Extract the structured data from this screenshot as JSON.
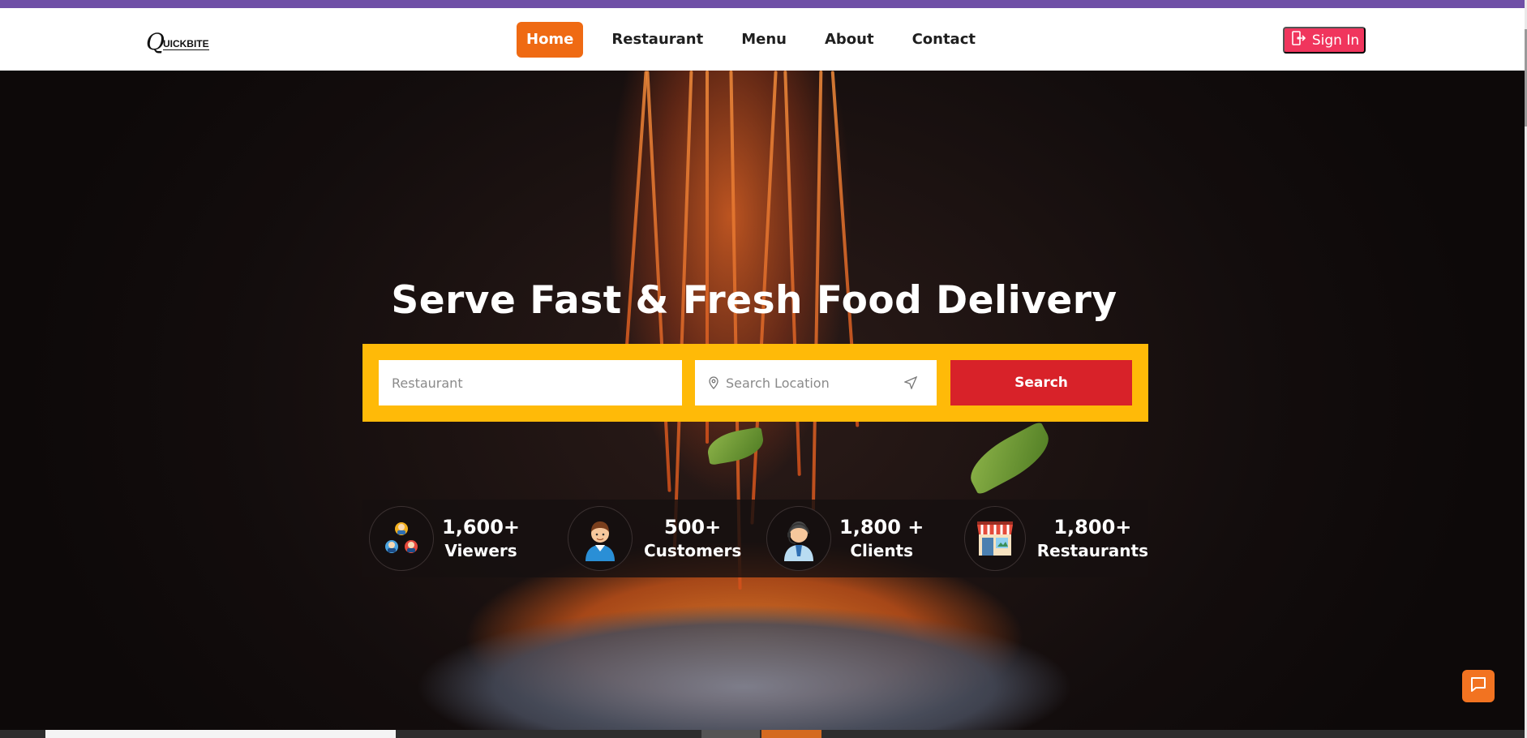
{
  "brand": {
    "logo_initial": "Q",
    "logo_rest": "UICKBITE"
  },
  "nav": {
    "items": [
      {
        "label": "Home",
        "active": true
      },
      {
        "label": "Restaurant",
        "active": false
      },
      {
        "label": "Menu",
        "active": false
      },
      {
        "label": "About",
        "active": false
      },
      {
        "label": "Contact",
        "active": false
      }
    ],
    "signin_label": "Sign In",
    "signin_icon": "sign-in-icon"
  },
  "hero": {
    "headline": "Serve Fast & Fresh Food Delivery"
  },
  "search": {
    "restaurant_placeholder": "Restaurant",
    "location_placeholder": "Search Location",
    "button_label": "Search"
  },
  "stats": [
    {
      "value": "1,600+",
      "label": "Viewers",
      "icon": "viewers-icon"
    },
    {
      "value": "500+",
      "label": "Customers",
      "icon": "customer-icon"
    },
    {
      "value": "1,800 +",
      "label": "Clients",
      "icon": "client-icon"
    },
    {
      "value": "1,800+",
      "label": "Restaurants",
      "icon": "restaurant-icon"
    }
  ],
  "colors": {
    "accent_orange": "#ef6a13",
    "signin_pink": "#f0355d",
    "search_yellow": "#ffba08",
    "search_red": "#d82229",
    "top_strip_purple": "#6f4fa6"
  }
}
